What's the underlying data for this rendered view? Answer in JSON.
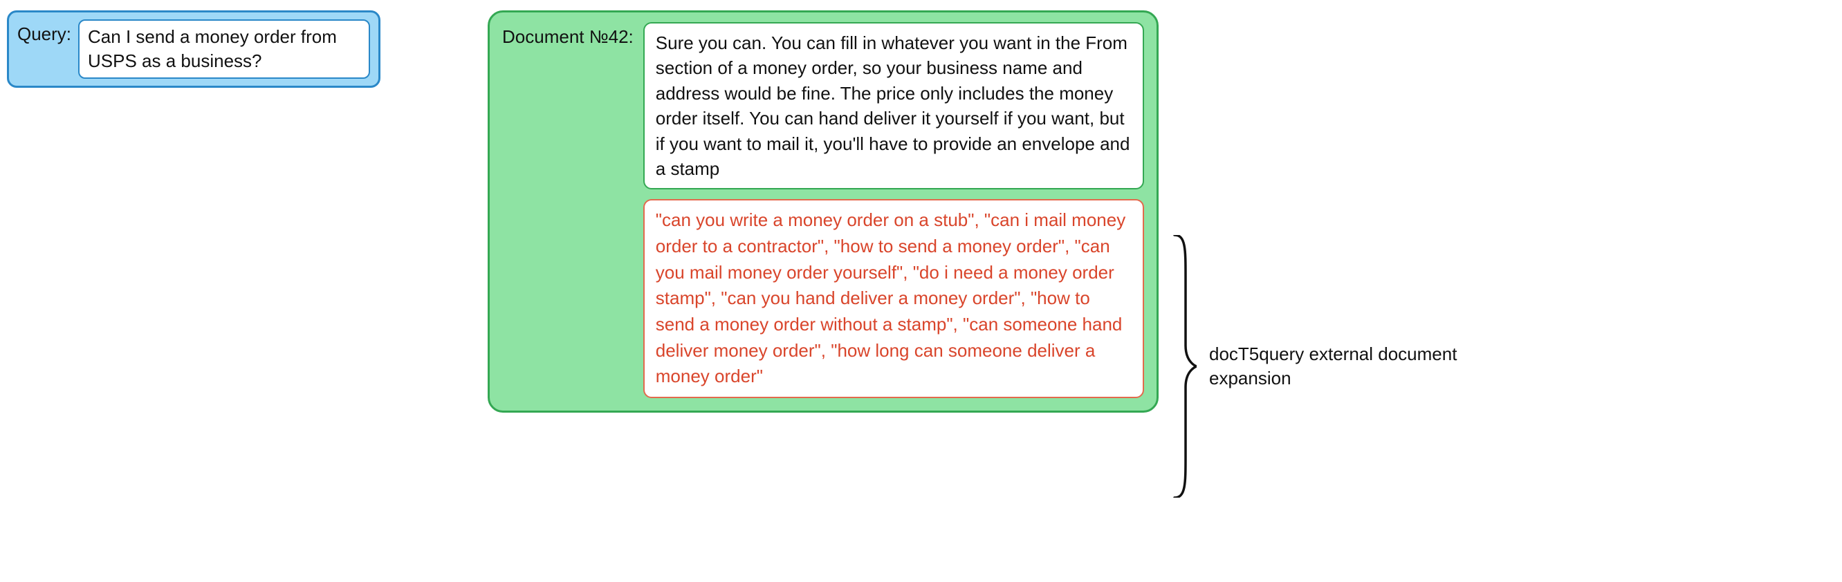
{
  "query": {
    "label": "Query:",
    "text": "Can I send a money order from USPS as a business?"
  },
  "document": {
    "label": "Document №42:",
    "text": "Sure you can. You can fill in whatever you want in the From section of a money order, so your business name and address would be fine. The price only includes the money order itself. You can hand deliver it yourself if you want, but if you want to mail it, you'll have to provide an envelope and a stamp",
    "expansion_text": "\"can you write a money order on a stub\", \"can i mail money order to a contractor\", \"how to send a money order\", \"can you mail money order yourself\", \"do i need a money order stamp\", \"can you hand deliver a money order\", \"how to send a money order without a stamp\", \"can someone hand deliver money order\", \"how long can someone deliver a money order\""
  },
  "caption": "docT5query external document expansion",
  "colors": {
    "query_bg": "#9ed8f7",
    "query_border": "#2a88c8",
    "doc_bg": "#8ee3a3",
    "doc_border": "#34a853",
    "expansion_border": "#e36a4d",
    "expansion_text": "#d9452b"
  }
}
